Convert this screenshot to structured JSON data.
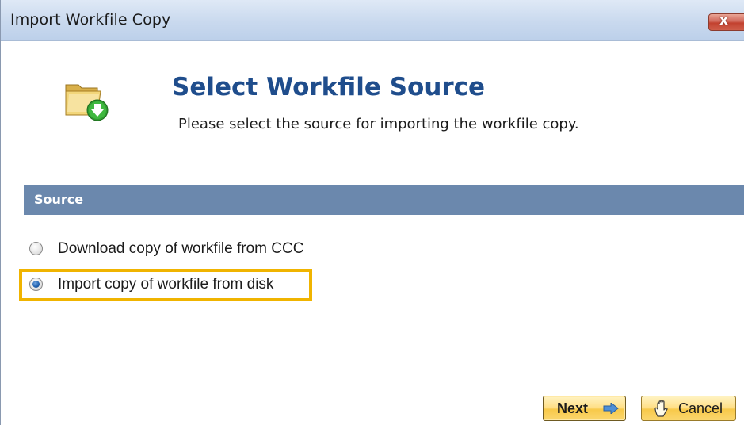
{
  "window": {
    "title": "Import Workfile Copy",
    "close_label": "x"
  },
  "header": {
    "icon": "folder-download-icon",
    "title": "Select Workfile Source",
    "subtitle": "Please select the source for importing the workfile copy."
  },
  "section": {
    "label": "Source"
  },
  "options": [
    {
      "label": "Download copy of workfile from CCC",
      "checked": false
    },
    {
      "label": "Import copy of workfile from disk",
      "checked": true,
      "highlighted": true
    }
  ],
  "buttons": {
    "next_label": "Next",
    "next_icon": "arrow-right-icon",
    "cancel_label": "Cancel",
    "cancel_icon": "hand-icon"
  },
  "colors": {
    "title_blue": "#1f4d8c",
    "section_bar": "#6b88ad",
    "highlight": "#f0b400",
    "button_gold": "#f8c94a"
  }
}
